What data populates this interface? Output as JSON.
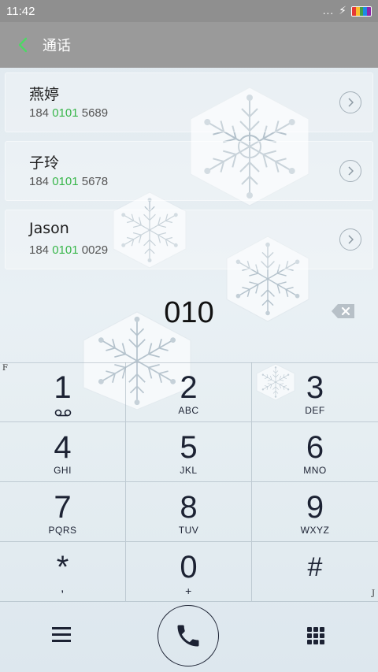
{
  "status_bar": {
    "time": "11:42",
    "dots": "...",
    "icons": [
      "notification-dots",
      "charging-bolt-icon",
      "battery-icon"
    ],
    "battery_colors": [
      "#e53935",
      "#fbc02d",
      "#43a047",
      "#1e88e5",
      "#8e24aa"
    ]
  },
  "header": {
    "back_icon": "chevron-left-icon",
    "title": "通话",
    "accent_color": "#4cd964"
  },
  "contacts": [
    {
      "name": "燕婷",
      "number_prefix": "184 ",
      "number_match": "0101",
      "number_suffix": " 5689"
    },
    {
      "name": "子玲",
      "number_prefix": "184 ",
      "number_match": "0101",
      "number_suffix": " 5678"
    },
    {
      "name": "Jason",
      "number_prefix": "184 ",
      "number_match": "0101",
      "number_suffix": " 0029"
    }
  ],
  "match_color": "#38b64a",
  "display": {
    "value": "010",
    "backspace_icon": "backspace-icon"
  },
  "keypad": [
    {
      "digit": "1",
      "letters": "",
      "sub_icon": "voicemail-icon"
    },
    {
      "digit": "2",
      "letters": "ABC"
    },
    {
      "digit": "3",
      "letters": "DEF"
    },
    {
      "digit": "4",
      "letters": "GHI"
    },
    {
      "digit": "5",
      "letters": "JKL"
    },
    {
      "digit": "6",
      "letters": "MNO"
    },
    {
      "digit": "7",
      "letters": "PQRS"
    },
    {
      "digit": "8",
      "letters": "TUV"
    },
    {
      "digit": "9",
      "letters": "WXYZ"
    },
    {
      "digit": "*",
      "letters": ","
    },
    {
      "digit": "0",
      "letters": "+"
    },
    {
      "digit": "#",
      "letters": ""
    }
  ],
  "side_letters": {
    "left": "F",
    "right": "J"
  },
  "bottom_bar": {
    "menu_icon": "menu-icon",
    "call_icon": "phone-icon",
    "keypad_toggle_icon": "dialpad-icon"
  }
}
